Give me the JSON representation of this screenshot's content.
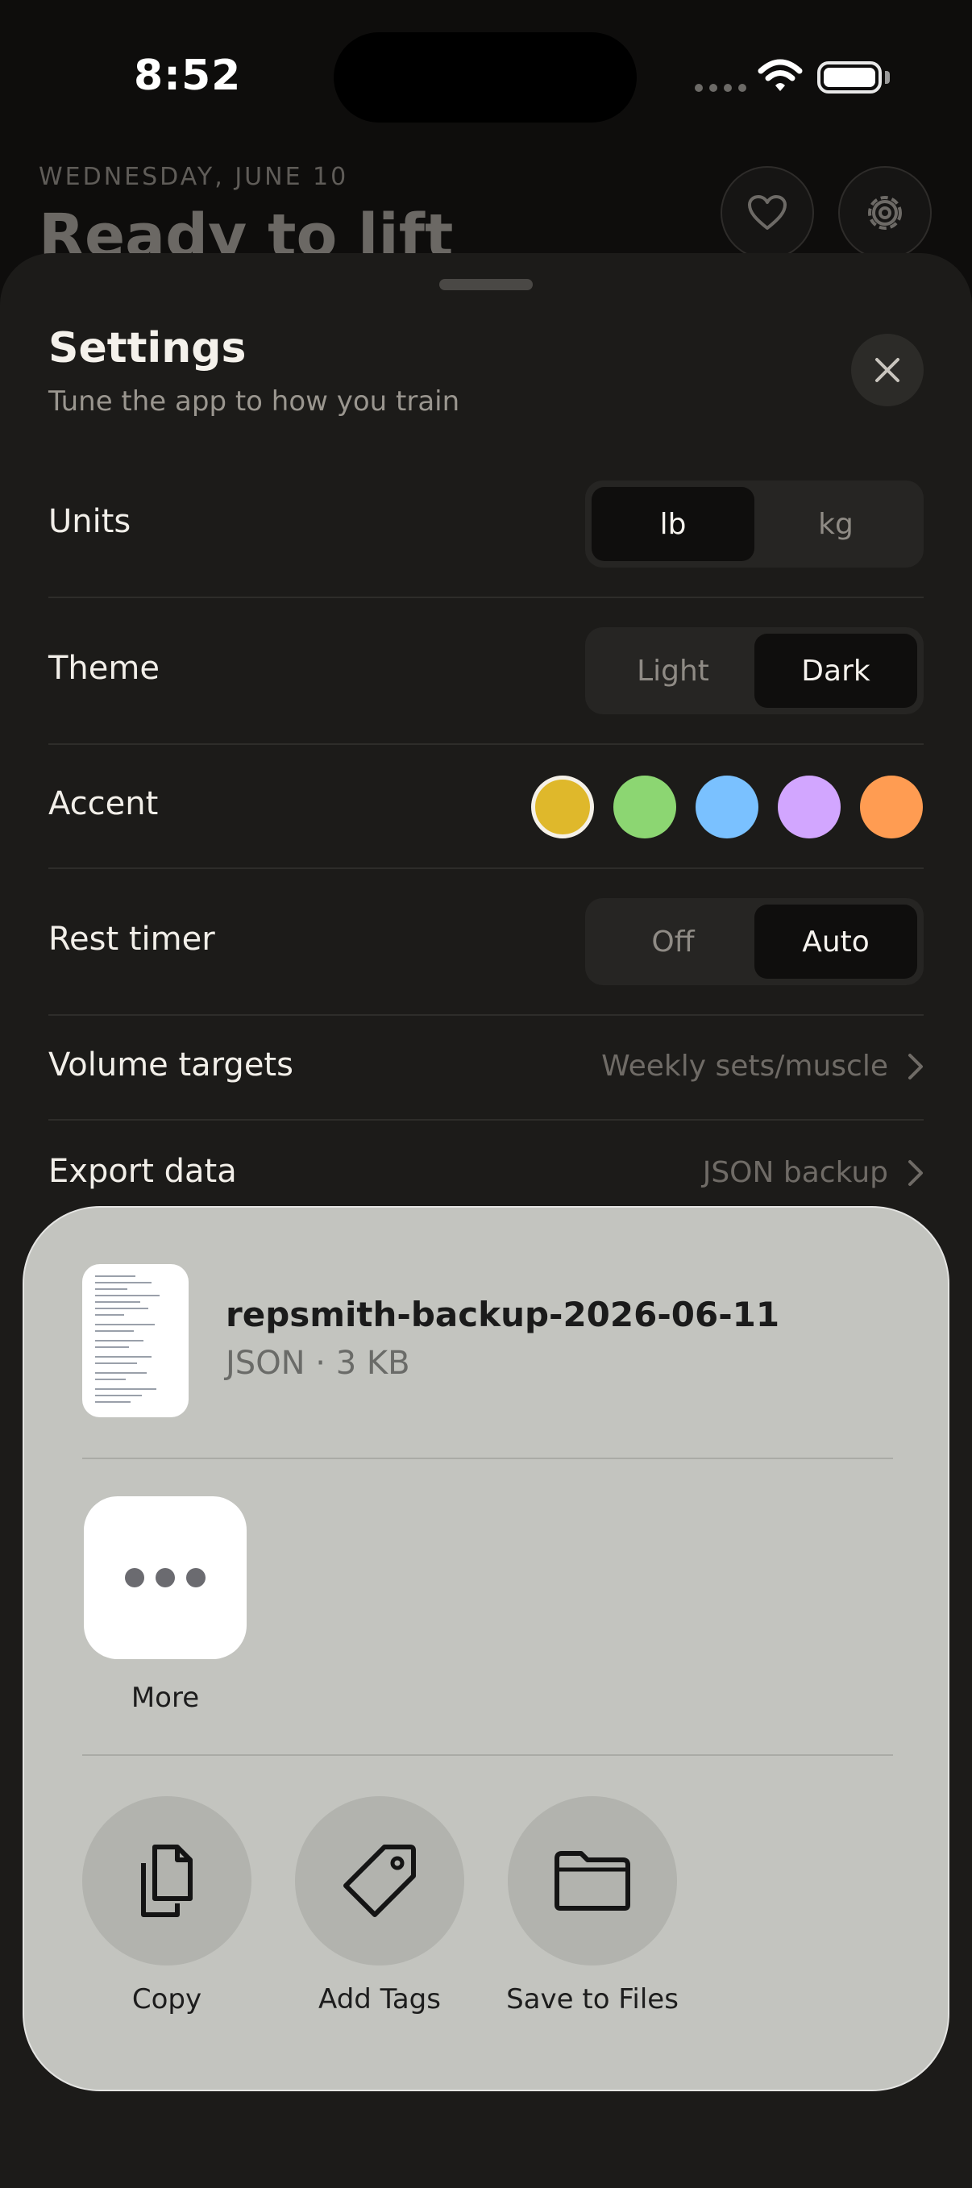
{
  "status_bar": {
    "time": "8:52"
  },
  "background_page": {
    "date": "WEDNESDAY, JUNE 10",
    "title": "Ready to lift",
    "icons": [
      "heart-icon",
      "gear-icon"
    ]
  },
  "settings": {
    "title": "Settings",
    "subtitle": "Tune the app to how you train",
    "units": {
      "label": "Units",
      "options": [
        "lb",
        "kg"
      ],
      "selected": "lb"
    },
    "theme": {
      "label": "Theme",
      "options": [
        "Light",
        "Dark"
      ],
      "selected": "Dark"
    },
    "accent": {
      "label": "Accent",
      "colors": [
        "#dfb82b",
        "#8cd672",
        "#7ac1ff",
        "#d2a6ff",
        "#ff9c52"
      ],
      "selected": "#dfb82b"
    },
    "rest_timer": {
      "label": "Rest timer",
      "options": [
        "Off",
        "Auto"
      ],
      "selected": "Auto"
    },
    "volume_targets": {
      "label": "Volume targets",
      "value": "Weekly sets/muscle"
    },
    "export_data": {
      "label": "Export data",
      "value": "JSON backup"
    }
  },
  "share_sheet": {
    "file_name": "repsmith-backup-2026-06-11",
    "file_meta": "JSON · 3 KB",
    "more_label": "More",
    "actions": [
      {
        "label": "Copy",
        "icon": "copy-icon"
      },
      {
        "label": "Add Tags",
        "icon": "tag-icon"
      },
      {
        "label": "Save to Files",
        "icon": "folder-icon"
      }
    ]
  }
}
